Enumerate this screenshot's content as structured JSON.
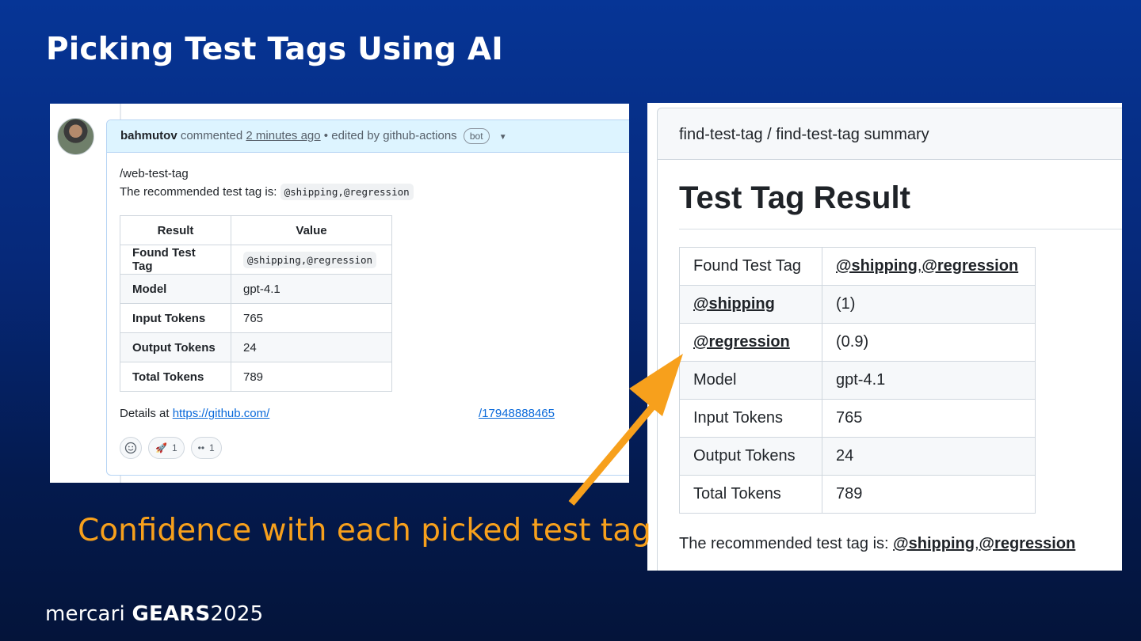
{
  "slide": {
    "title": "Picking Test Tags Using AI",
    "annotation": "Confidence with each picked test tag",
    "brand": {
      "name": "mercari",
      "event": "GEARS",
      "year": "2025"
    },
    "colors": {
      "annotation": "#f7a01c",
      "background": "#063596"
    }
  },
  "comment": {
    "author": "bahmutov",
    "action": "commented",
    "time": "2 minutes ago",
    "separator": "•",
    "edited_by": "edited by github-actions",
    "badge": "bot",
    "command": "/web-test-tag",
    "recommended_prefix": "The recommended test tag is:",
    "recommended_value": "@shipping,@regression",
    "table": {
      "headers": [
        "Result",
        "Value"
      ],
      "rows": [
        {
          "key": "Found Test Tag",
          "value": "@shipping,@regression"
        },
        {
          "key": "Model",
          "value": "gpt-4.1"
        },
        {
          "key": "Input Tokens",
          "value": "765"
        },
        {
          "key": "Output Tokens",
          "value": "24"
        },
        {
          "key": "Total Tokens",
          "value": "789"
        }
      ]
    },
    "details_prefix": "Details at",
    "details_link": "https://github.com/",
    "details_link_end": "/17948888465",
    "reactions": [
      {
        "icon": "rocket-icon",
        "emoji": "🚀",
        "count": "1"
      },
      {
        "icon": "eyes-icon",
        "emoji": "••",
        "count": "1"
      }
    ]
  },
  "summary": {
    "header": "find-test-tag / find-test-tag summary",
    "title": "Test Tag Result",
    "rows": [
      {
        "key": "Found Test Tag",
        "tags": [
          "@shipping",
          "@regression"
        ]
      },
      {
        "key": "@shipping",
        "key_is_tag": true,
        "value": "(1)"
      },
      {
        "key": "@regression",
        "key_is_tag": true,
        "value": "(0.9)"
      },
      {
        "key": "Model",
        "value": "gpt-4.1"
      },
      {
        "key": "Input Tokens",
        "value": "765"
      },
      {
        "key": "Output Tokens",
        "value": "24"
      },
      {
        "key": "Total Tokens",
        "value": "789"
      }
    ],
    "recommended_prefix": "The recommended test tag is:",
    "recommended_tags": [
      "@shipping",
      "@regression"
    ]
  }
}
